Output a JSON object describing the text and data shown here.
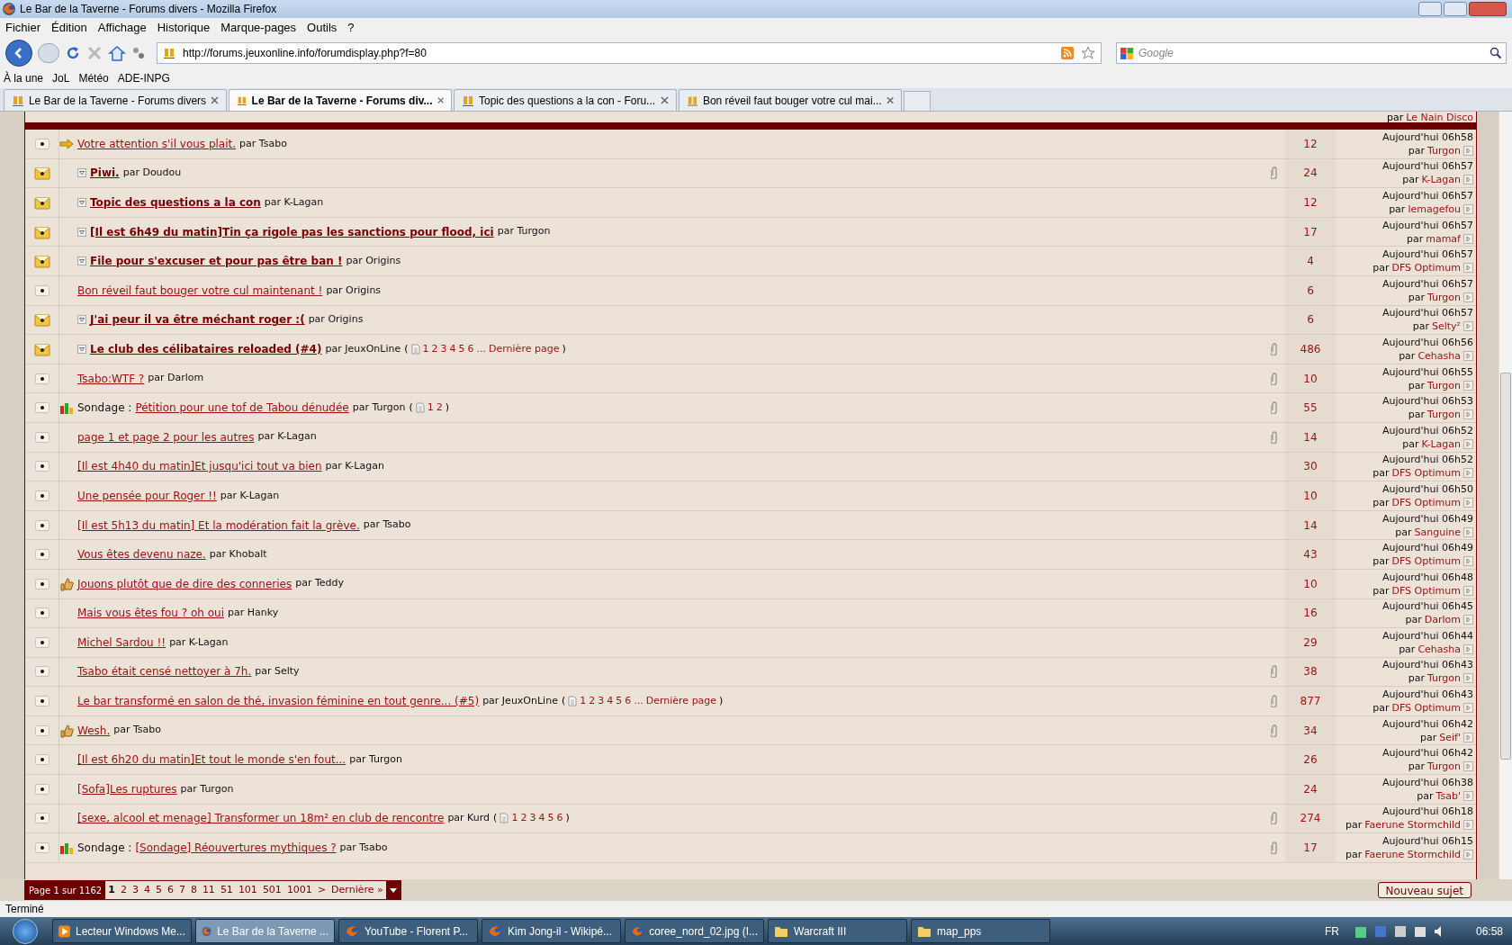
{
  "window": {
    "title": "Le Bar de la Taverne - Forums divers - Mozilla Firefox"
  },
  "menu": [
    "Fichier",
    "Édition",
    "Affichage",
    "Historique",
    "Marque-pages",
    "Outils",
    "?"
  ],
  "address": "http://forums.jeuxonline.info/forumdisplay.php?f=80",
  "search": {
    "placeholder": "Google"
  },
  "bookmarks": [
    "À la une",
    "JoL",
    "Météo",
    "ADE-INPG"
  ],
  "tabs": [
    {
      "label": "Le Bar de la Taverne - Forums divers",
      "selected": false
    },
    {
      "label": "Le Bar de la Taverne - Forums div...",
      "selected": true
    },
    {
      "label": "Topic des questions a la con - Foru...",
      "selected": false
    },
    {
      "label": "Bon réveil faut bouger votre cul mai...",
      "selected": false
    }
  ],
  "previous_row": {
    "label": "par",
    "name": "Le Nain Disco"
  },
  "topics": [
    {
      "kind": "notice",
      "title": "Votre attention s'il vous plait.",
      "unread": false,
      "author": "par Tsabo",
      "attachment": false,
      "replies": "12",
      "time": "Aujourd'hui 06h58",
      "by": "par",
      "last": "Turgon"
    },
    {
      "kind": "new",
      "title": "Piwi.",
      "unread": true,
      "author": "par Doudou",
      "attachment": true,
      "replies": "24",
      "time": "Aujourd'hui 06h57",
      "by": "par",
      "last": "K-Lagan"
    },
    {
      "kind": "new",
      "title": "Topic des questions a la con",
      "unread": true,
      "author": "par K-Lagan",
      "attachment": false,
      "replies": "12",
      "time": "Aujourd'hui 06h57",
      "by": "par",
      "last": "lemagefou"
    },
    {
      "kind": "new",
      "title": "[Il est 6h49 du matin]Tin ça rigole pas les sanctions pour flood, ici",
      "unread": true,
      "author": "par Turgon",
      "attachment": false,
      "replies": "17",
      "time": "Aujourd'hui 06h57",
      "by": "par",
      "last": "mamaf"
    },
    {
      "kind": "new",
      "title": "File pour s'excuser et pour pas être ban !",
      "unread": true,
      "author": "par Origins",
      "attachment": false,
      "replies": "4",
      "time": "Aujourd'hui 06h57",
      "by": "par",
      "last": "DFS Optimum"
    },
    {
      "kind": "read",
      "title": "Bon réveil faut bouger votre cul maintenant !",
      "unread": false,
      "author": "par Origins",
      "attachment": false,
      "replies": "6",
      "time": "Aujourd'hui 06h57",
      "by": "par",
      "last": "Turgon"
    },
    {
      "kind": "new",
      "title": "J'ai peur il va être méchant roger :(",
      "unread": true,
      "author": "par Origins",
      "attachment": false,
      "replies": "6",
      "time": "Aujourd'hui 06h57",
      "by": "par",
      "last": "Selty²"
    },
    {
      "kind": "new",
      "title": "Le club des célibataires reloaded (#4)",
      "unread": true,
      "author": "par JeuxOnLine",
      "pages": {
        "open": "(",
        "links": [
          "1",
          "2",
          "3",
          "4",
          "5",
          "6",
          "...",
          "Dernière page"
        ],
        "close": ")"
      },
      "attachment": true,
      "replies": "486",
      "time": "Aujourd'hui 06h56",
      "by": "par",
      "last": "Cehasha"
    },
    {
      "kind": "read",
      "title": "Tsabo:WTF ?",
      "unread": false,
      "author": "par Darlom",
      "attachment": true,
      "replies": "10",
      "time": "Aujourd'hui 06h55",
      "by": "par",
      "last": "Turgon"
    },
    {
      "kind": "poll",
      "prefix": "Sondage :",
      "title": "Pétition pour une tof de Tabou dénudée",
      "unread": false,
      "author": "par Turgon",
      "pages": {
        "open": "(",
        "links": [
          "1",
          "2"
        ],
        "close": ")"
      },
      "attachment": true,
      "replies": "55",
      "time": "Aujourd'hui 06h53",
      "by": "par",
      "last": "Turgon"
    },
    {
      "kind": "read",
      "title": "page 1 et page 2 pour les autres",
      "unread": false,
      "author": "par K-Lagan",
      "attachment": true,
      "replies": "14",
      "time": "Aujourd'hui 06h52",
      "by": "par",
      "last": "K-Lagan"
    },
    {
      "kind": "read",
      "title": "[Il est 4h40 du matin]Et jusqu'ici tout va bien",
      "unread": false,
      "author": "par K-Lagan",
      "attachment": false,
      "replies": "30",
      "time": "Aujourd'hui 06h52",
      "by": "par",
      "last": "DFS Optimum"
    },
    {
      "kind": "read",
      "title": "Une pensée pour Roger !!",
      "unread": false,
      "author": "par K-Lagan",
      "attachment": false,
      "replies": "10",
      "time": "Aujourd'hui 06h50",
      "by": "par",
      "last": "DFS Optimum"
    },
    {
      "kind": "read",
      "title": "[Il est 5h13 du matin] Et la modération fait la grève.",
      "unread": false,
      "author": "par Tsabo",
      "attachment": false,
      "replies": "14",
      "time": "Aujourd'hui 06h49",
      "by": "par",
      "last": "Sanguine"
    },
    {
      "kind": "read",
      "title": "Vous êtes devenu naze.",
      "unread": false,
      "author": "par Khobalt",
      "attachment": false,
      "replies": "43",
      "time": "Aujourd'hui 06h49",
      "by": "par",
      "last": "DFS Optimum"
    },
    {
      "kind": "thumb",
      "title": "Jouons plutôt que de dire des conneries",
      "unread": false,
      "author": "par Teddy",
      "attachment": false,
      "replies": "10",
      "time": "Aujourd'hui 06h48",
      "by": "par",
      "last": "DFS Optimum"
    },
    {
      "kind": "read",
      "title": "Mais vous êtes fou ? oh oui",
      "unread": false,
      "author": "par Hanky",
      "attachment": false,
      "replies": "16",
      "time": "Aujourd'hui 06h45",
      "by": "par",
      "last": "Darlom"
    },
    {
      "kind": "read",
      "title": "Michel Sardou !!",
      "unread": false,
      "author": "par K-Lagan",
      "attachment": false,
      "replies": "29",
      "time": "Aujourd'hui 06h44",
      "by": "par",
      "last": "Cehasha"
    },
    {
      "kind": "read",
      "title": "Tsabo était censé nettoyer à 7h.",
      "unread": false,
      "author": "par Selty",
      "attachment": true,
      "replies": "38",
      "time": "Aujourd'hui 06h43",
      "by": "par",
      "last": "Turgon"
    },
    {
      "kind": "read",
      "title": "Le bar transformé en salon de thé, invasion féminine en tout genre... (#5)",
      "unread": false,
      "author": "par JeuxOnLine",
      "pages": {
        "open": "(",
        "links": [
          "1",
          "2",
          "3",
          "4",
          "5",
          "6",
          "...",
          "Dernière page"
        ],
        "close": ")"
      },
      "attachment": true,
      "replies": "877",
      "time": "Aujourd'hui 06h43",
      "by": "par",
      "last": "DFS Optimum"
    },
    {
      "kind": "thumb",
      "title": "Wesh.",
      "unread": false,
      "author": "par Tsabo",
      "attachment": true,
      "replies": "34",
      "time": "Aujourd'hui 06h42",
      "by": "par",
      "last": "Seif'"
    },
    {
      "kind": "read",
      "title": "[Il est 6h20 du matin]Et tout le monde s'en fout...",
      "unread": false,
      "author": "par Turgon",
      "attachment": false,
      "replies": "26",
      "time": "Aujourd'hui 06h42",
      "by": "par",
      "last": "Turgon"
    },
    {
      "kind": "read",
      "title": "[Sofa]Les ruptures",
      "unread": false,
      "author": "par Turgon",
      "attachment": false,
      "replies": "24",
      "time": "Aujourd'hui 06h38",
      "by": "par",
      "last": "Tsab'"
    },
    {
      "kind": "read",
      "title": "[sexe, alcool et menage] Transformer un 18m² en club de rencontre",
      "unread": false,
      "author": "par Kurd",
      "pages": {
        "open": "(",
        "links": [
          "1",
          "2",
          "3",
          "4",
          "5",
          "6"
        ],
        "close": ")"
      },
      "attachment": true,
      "replies": "274",
      "time": "Aujourd'hui 06h18",
      "by": "par",
      "last": "Faerune Stormchild"
    },
    {
      "kind": "poll",
      "prefix": "Sondage :",
      "title": "[Sondage] Réouvertures mythiques ?",
      "unread": false,
      "author": "par Tsabo",
      "attachment": true,
      "replies": "17",
      "time": "Aujourd'hui 06h15",
      "by": "par",
      "last": "Faerune Stormchild"
    }
  ],
  "pagination": {
    "label": "Page 1 sur 1162",
    "pages": [
      {
        "label": "1",
        "selected": true
      },
      {
        "label": "2",
        "selected": false
      },
      {
        "label": "3",
        "selected": false
      },
      {
        "label": "4",
        "selected": false
      },
      {
        "label": "5",
        "selected": false
      },
      {
        "label": "6",
        "selected": false
      },
      {
        "label": "7",
        "selected": false
      },
      {
        "label": "8",
        "selected": false
      },
      {
        "label": "11",
        "selected": false
      },
      {
        "label": "51",
        "selected": false
      },
      {
        "label": "101",
        "selected": false
      },
      {
        "label": "501",
        "selected": false
      },
      {
        "label": "1001",
        "selected": false
      },
      {
        "label": ">",
        "selected": false
      },
      {
        "label": "Dernière »",
        "selected": false
      }
    ]
  },
  "new_topic": "Nouveau sujet",
  "status_bar": "Terminé",
  "taskbar": [
    {
      "label": "Lecteur Windows Me...",
      "kind": "media",
      "selected": false
    },
    {
      "label": "Le Bar de la Taverne ...",
      "kind": "firefox",
      "selected": true
    },
    {
      "label": "YouTube - Florent P...",
      "kind": "firefox",
      "selected": false
    },
    {
      "label": "Kim Jong-il - Wikipé...",
      "kind": "firefox",
      "selected": false
    },
    {
      "label": "coree_nord_02.jpg (I...",
      "kind": "firefox",
      "selected": false
    },
    {
      "label": "Warcraft III",
      "kind": "folder",
      "selected": false
    },
    {
      "label": "map_pps",
      "kind": "folder",
      "selected": false
    }
  ],
  "tray": {
    "language": "FR",
    "clock": "06:58"
  }
}
